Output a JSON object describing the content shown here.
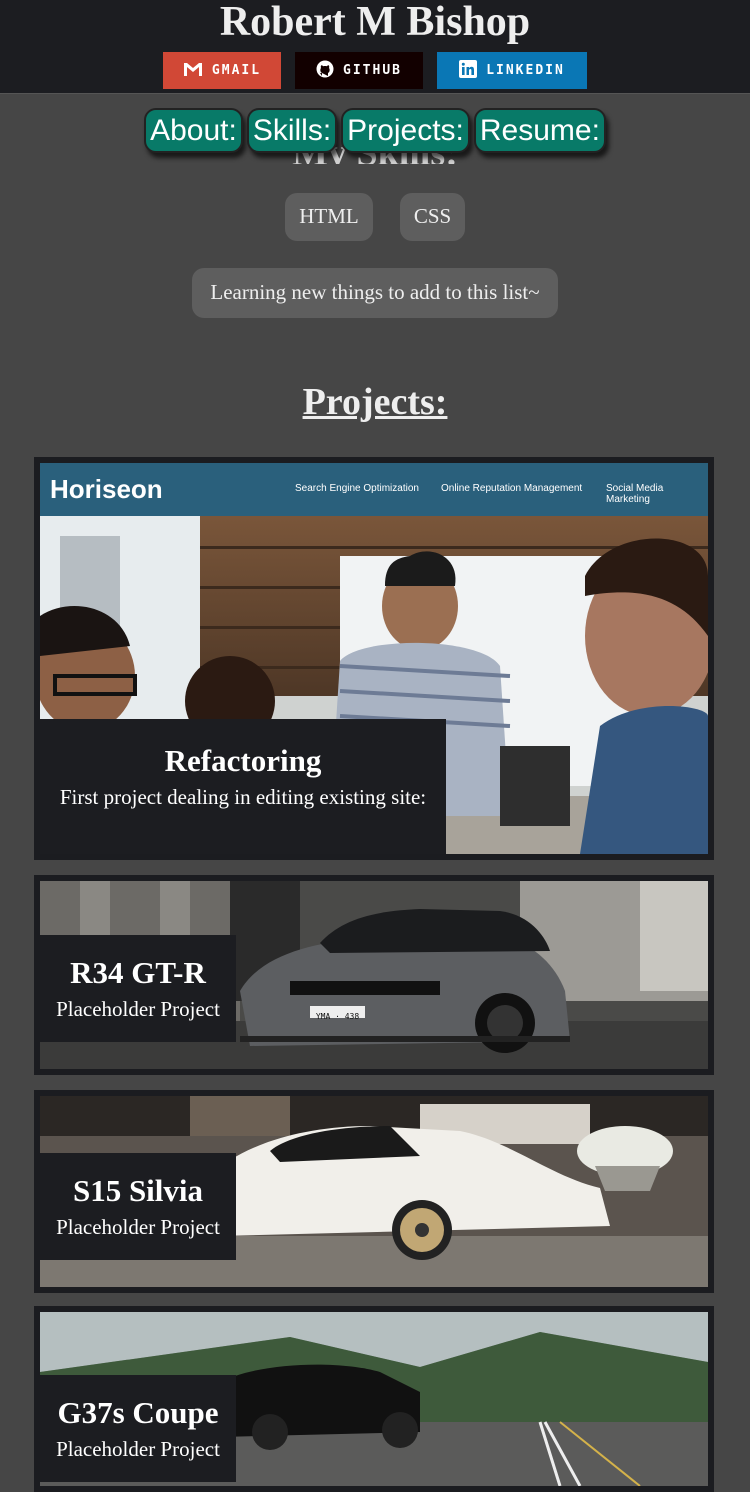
{
  "header": {
    "title": "Robert M Bishop",
    "badges": [
      {
        "label": "GMAIL",
        "icon": "gmail-icon",
        "color": "#d14836"
      },
      {
        "label": "GITHUB",
        "icon": "github-icon",
        "color": "#120000"
      },
      {
        "label": "LINKEDIN",
        "icon": "linkedin-icon",
        "color": "#0a77b5"
      }
    ]
  },
  "nav": {
    "items": [
      "About:",
      "Skills:",
      "Projects:",
      "Resume:"
    ]
  },
  "skills": {
    "heading": "My Skills:",
    "items": [
      "HTML",
      "CSS"
    ],
    "learning": "Learning new things to add to this list~"
  },
  "projects": {
    "heading": "Projects:",
    "items": [
      {
        "title": "Refactoring",
        "subtitle": "First project dealing in editing existing site:"
      },
      {
        "title": "R34 GT-R",
        "subtitle": "Placeholder Project"
      },
      {
        "title": "S15 Silvia",
        "subtitle": "Placeholder Project"
      },
      {
        "title": "G37s Coupe",
        "subtitle": "Placeholder Project"
      }
    ],
    "horiseon": {
      "logo": "Horiseon",
      "links": [
        "Search Engine Optimization",
        "Online Reputation Management",
        "Social Media Marketing"
      ]
    },
    "plate": "YMA · 438"
  },
  "colors": {
    "accent": "#087a68",
    "background": "#464646",
    "header": "#1c1d21"
  }
}
